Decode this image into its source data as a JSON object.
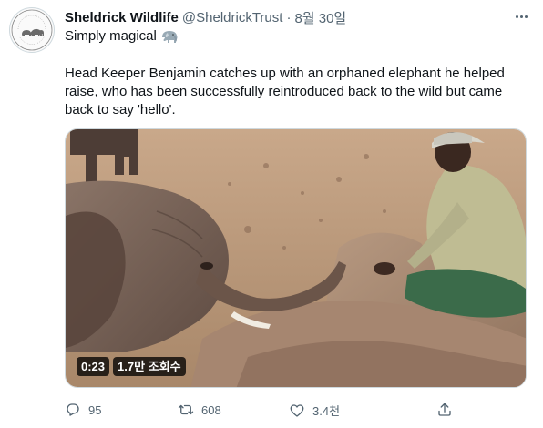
{
  "tweet": {
    "display_name": "Sheldrick Wildlife",
    "handle": "@SheldrickTrust",
    "separator": "·",
    "date": "8월 30일",
    "subline": "Simply magical",
    "body": "Head Keeper Benjamin catches up with an orphaned elephant he helped raise, who has been successfully reintroduced back to the wild but came back to say 'hello'.",
    "avatar_text_top": "SHELDRICK",
    "avatar_text_bottom": "WILDLIFE TRUST"
  },
  "media": {
    "duration": "0:23",
    "views": "1.7만 조회수"
  },
  "actions": {
    "replies": "95",
    "retweets": "608",
    "likes": "3.4천"
  },
  "colors": {
    "text": "#0f1419",
    "secondary": "#536471",
    "border": "#cfd9de",
    "retweet_green": "#00ba7c"
  },
  "icons": {
    "more": "more-horizontal-icon",
    "reply": "reply-icon",
    "retweet": "retweet-icon",
    "like": "heart-icon",
    "share": "share-icon",
    "emoji": "elephant-emoji-icon"
  }
}
